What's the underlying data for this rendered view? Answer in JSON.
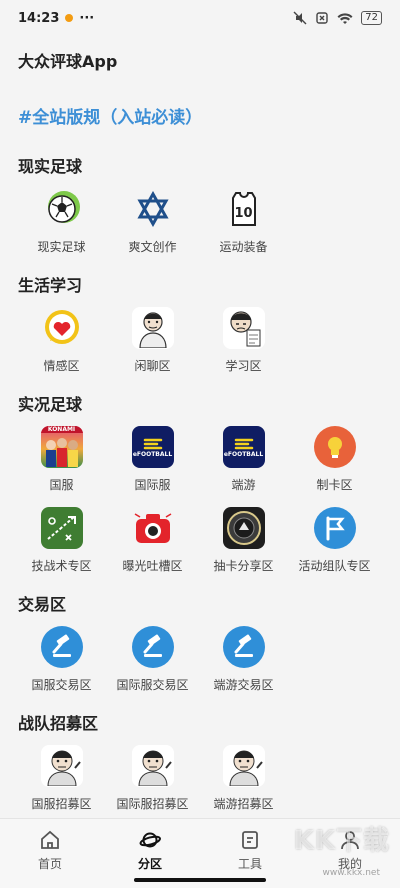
{
  "status": {
    "time": "14:23",
    "dots": "···",
    "battery": "72"
  },
  "app_title": "大众评球App",
  "rules_link": "#全站版规（入站必读）",
  "sections": [
    {
      "title": "现实足球",
      "items": [
        {
          "label": "现实足球",
          "icon": "soccer-ball-icon"
        },
        {
          "label": "爽文创作",
          "icon": "star-of-david-icon"
        },
        {
          "label": "运动装备",
          "icon": "jersey-icon",
          "badge": "10"
        }
      ]
    },
    {
      "title": "生活学习",
      "items": [
        {
          "label": "情感区",
          "icon": "heart-bubble-icon"
        },
        {
          "label": "闲聊区",
          "icon": "chat-meme-icon"
        },
        {
          "label": "学习区",
          "icon": "study-meme-icon"
        }
      ]
    },
    {
      "title": "实况足球",
      "items": [
        {
          "label": "国服",
          "icon": "konami-cover-icon",
          "badge": "KONAMI"
        },
        {
          "label": "国际服",
          "icon": "efootball-icon",
          "badge": "eFOOTBALL"
        },
        {
          "label": "端游",
          "icon": "efootball-icon",
          "badge": "eFOOTBALL"
        },
        {
          "label": "制卡区",
          "icon": "lightbulb-icon"
        },
        {
          "label": "技战术专区",
          "icon": "tactics-board-icon"
        },
        {
          "label": "曝光吐槽区",
          "icon": "camera-icon"
        },
        {
          "label": "抽卡分享区",
          "icon": "card-badge-icon"
        },
        {
          "label": "活动组队专区",
          "icon": "flag-icon"
        }
      ]
    },
    {
      "title": "交易区",
      "items": [
        {
          "label": "国服交易区",
          "icon": "gavel-icon"
        },
        {
          "label": "国际服交易区",
          "icon": "gavel-icon"
        },
        {
          "label": "端游交易区",
          "icon": "gavel-icon"
        }
      ]
    },
    {
      "title": "战队招募区",
      "items": [
        {
          "label": "国服招募区",
          "icon": "recruit-meme-icon"
        },
        {
          "label": "国际服招募区",
          "icon": "recruit-meme-icon"
        },
        {
          "label": "端游招募区",
          "icon": "recruit-meme-icon"
        }
      ]
    }
  ],
  "tabs": [
    {
      "label": "首页",
      "icon": "home-icon"
    },
    {
      "label": "分区",
      "icon": "planet-icon",
      "active": true
    },
    {
      "label": "工具",
      "icon": "tool-icon"
    },
    {
      "label": "我的",
      "icon": "profile-icon"
    }
  ],
  "watermark": {
    "text": "KK下载",
    "url": "www.kkx.net"
  },
  "colors": {
    "accent": "#3d8fd6",
    "blue_circle": "#2f8fd8",
    "efootball_bg": "#0f1d63"
  }
}
